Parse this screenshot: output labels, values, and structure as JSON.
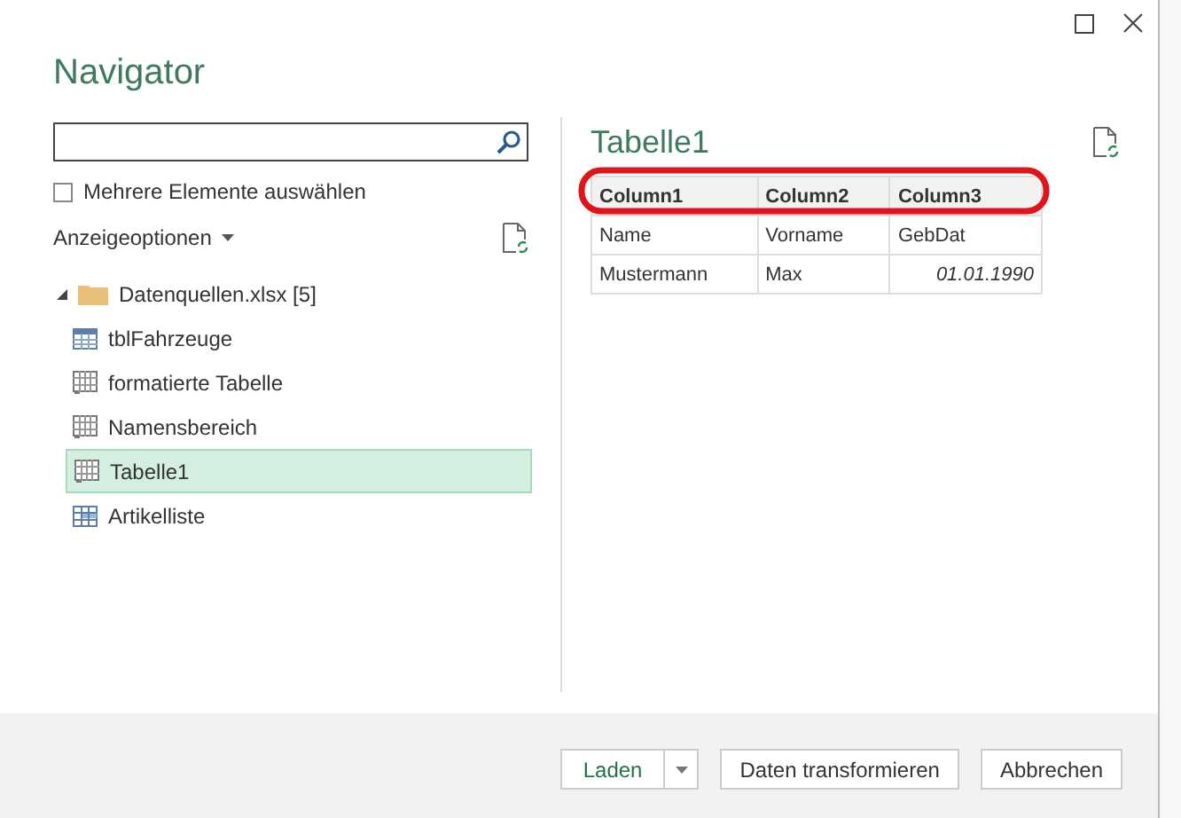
{
  "window": {
    "title": "Navigator"
  },
  "multi_select": {
    "label": "Mehrere Elemente auswählen",
    "checked": false
  },
  "display_options": {
    "label": "Anzeigeoptionen"
  },
  "tree": [
    {
      "label": "Datenquellen.xlsx [5]",
      "kind": "folder",
      "expanded": true,
      "selected": false,
      "children": [
        {
          "label": "tblFahrzeuge",
          "kind": "table",
          "selected": false
        },
        {
          "label": "formatierte Tabelle",
          "kind": "sheet",
          "selected": false
        },
        {
          "label": "Namensbereich",
          "kind": "sheet",
          "selected": false
        },
        {
          "label": "Tabelle1",
          "kind": "sheet",
          "selected": true
        },
        {
          "label": "Artikelliste",
          "kind": "grid",
          "selected": false
        }
      ]
    }
  ],
  "preview": {
    "title": "Tabelle1",
    "columns": [
      "Column1",
      "Column2",
      "Column3"
    ],
    "rows": [
      [
        {
          "text": "Name",
          "kind": "text"
        },
        {
          "text": "Vorname",
          "kind": "text"
        },
        {
          "text": "GebDat",
          "kind": "text"
        }
      ],
      [
        {
          "text": "Mustermann",
          "kind": "text"
        },
        {
          "text": "Max",
          "kind": "text"
        },
        {
          "text": "01.01.1990",
          "kind": "date"
        }
      ]
    ]
  },
  "buttons": [
    {
      "label": "Laden",
      "kind": "split"
    },
    {
      "label": "Daten transformieren",
      "kind": "plain"
    },
    {
      "label": "Abbrechen",
      "kind": "plain"
    }
  ]
}
